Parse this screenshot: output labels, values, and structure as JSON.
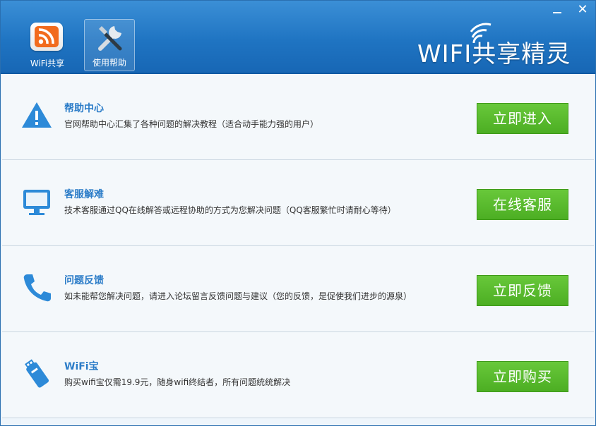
{
  "window": {
    "logo_text": "WIFI共享精灵",
    "tabs": [
      {
        "label": "WiFi共享"
      },
      {
        "label": "使用帮助"
      }
    ]
  },
  "rows": [
    {
      "icon": "warning-icon",
      "title": "帮助中心",
      "desc": "官网帮助中心汇集了各种问题的解决教程（适合动手能力强的用户）",
      "button": "立即进入"
    },
    {
      "icon": "monitor-icon",
      "title": "客服解难",
      "desc": "技术客服通过QQ在线解答或远程协助的方式为您解决问题（QQ客服繁忙时请耐心等待）",
      "button": "在线客服"
    },
    {
      "icon": "phone-icon",
      "title": "问题反馈",
      "desc": "如未能帮您解决问题，请进入论坛留言反馈问题与建议（您的反馈，是促使我们进步的源泉）",
      "button": "立即反馈"
    },
    {
      "icon": "usb-wifi-icon",
      "title": "WiFi宝",
      "desc": "购买wifi宝仅需19.9元，随身wifi终结者，所有问题统统解决",
      "button": "立即购买"
    }
  ],
  "colors": {
    "header": "#1f74c2",
    "accent_blue": "#2b7cc8",
    "button_green": "#5bbb2e"
  }
}
